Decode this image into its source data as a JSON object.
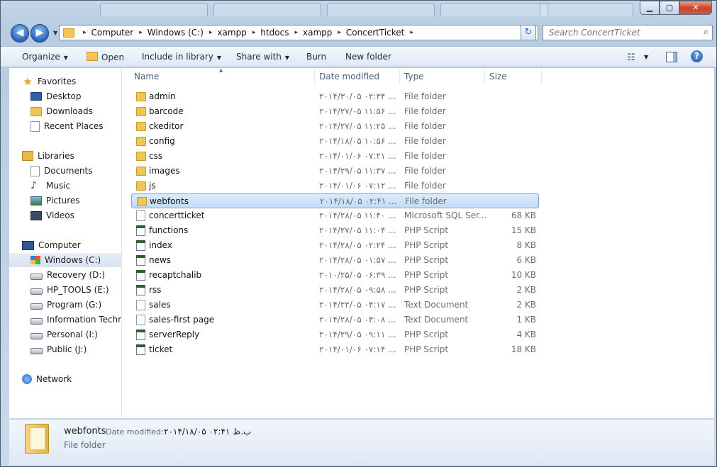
{
  "window": {
    "controls": {
      "minimize": "▁",
      "maximize": "▢",
      "close": "✕"
    }
  },
  "nav": {
    "back": "◀",
    "forward": "▶",
    "dropdown": "▼"
  },
  "address": {
    "crumbs": [
      "Computer",
      "Windows (C:)",
      "xampp",
      "htdocs",
      "xampp",
      "ConcertTicket"
    ],
    "refresh_icon": "↻"
  },
  "search": {
    "placeholder": "Search ConcertTicket"
  },
  "toolbar": {
    "organize": "Organize",
    "open": "Open",
    "include_in_library": "Include in library",
    "share_with": "Share with",
    "burn": "Burn",
    "new_folder": "New folder",
    "help": "?"
  },
  "navpane": {
    "favorites": "Favorites",
    "desktop": "Desktop",
    "downloads": "Downloads",
    "recent_places": "Recent Places",
    "libraries": "Libraries",
    "documents": "Documents",
    "music": "Music",
    "pictures": "Pictures",
    "videos": "Videos",
    "computer": "Computer",
    "drives": [
      "Windows (C:)",
      "Recovery (D:)",
      "HP_TOOLS (E:)",
      "Program (G:)",
      "Information Techno",
      "Personal (I:)",
      "Public (J:)"
    ],
    "network": "Network"
  },
  "columns": {
    "name": "Name",
    "date": "Date modified",
    "type": "Type",
    "size": "Size"
  },
  "files": [
    {
      "name": "admin",
      "date": "۲۰۱۴/۳۰/۰۵ ۰۲:۳۴ ...",
      "type": "File folder",
      "size": "",
      "icon": "folder-icon"
    },
    {
      "name": "barcode",
      "date": "۲۰۱۴/۲۷/۰۵ ۱۱:۵۶ ...",
      "type": "File folder",
      "size": "",
      "icon": "folder-icon"
    },
    {
      "name": "ckeditor",
      "date": "۲۰۱۴/۲۷/۰۵ ۱۱:۲۵ ...",
      "type": "File folder",
      "size": "",
      "icon": "folder-icon"
    },
    {
      "name": "config",
      "date": "۲۰۱۴/۱۸/۰۵ ۱۰:۵۶ ...",
      "type": "File folder",
      "size": "",
      "icon": "folder-icon"
    },
    {
      "name": "css",
      "date": "۲۰۱۴/۰۱/۰۶ ۰۷:۲۱ ...",
      "type": "File folder",
      "size": "",
      "icon": "folder-icon"
    },
    {
      "name": "images",
      "date": "۲۰۱۴/۲۹/۰۵ ۱۱:۳۷ ...",
      "type": "File folder",
      "size": "",
      "icon": "folder-icon"
    },
    {
      "name": "js",
      "date": "۲۰۱۴/۰۱/۰۶ ۰۷:۱۲ ...",
      "type": "File folder",
      "size": "",
      "icon": "folder-icon"
    },
    {
      "name": "webfonts",
      "date": "۲۰۱۴/۱۸/۰۵ ۰۲:۴۱ ...",
      "type": "File folder",
      "size": "",
      "icon": "folder-icon"
    },
    {
      "name": "concertticket",
      "date": "۲۰۱۴/۲۸/۰۵ ۱۱:۴۰ ...",
      "type": "Microsoft SQL Ser...",
      "size": "68 KB",
      "icon": "sql-file-icon"
    },
    {
      "name": "functions",
      "date": "۲۰۱۴/۲۷/۰۵ ۱۱:۰۴ ...",
      "type": "PHP Script",
      "size": "15 KB",
      "icon": "php-file-icon"
    },
    {
      "name": "index",
      "date": "۲۰۱۴/۲۸/۰۵ ۰۲:۲۴ ...",
      "type": "PHP Script",
      "size": "8 KB",
      "icon": "php-file-icon"
    },
    {
      "name": "news",
      "date": "۲۰۱۴/۲۸/۰۵ ۰۱:۵۷ ...",
      "type": "PHP Script",
      "size": "6 KB",
      "icon": "php-file-icon"
    },
    {
      "name": "recaptchalib",
      "date": "۲۰۱۰/۲۵/۰۵ ۰۶:۳۹ ...",
      "type": "PHP Script",
      "size": "10 KB",
      "icon": "php-file-icon"
    },
    {
      "name": "rss",
      "date": "۲۰۱۴/۲۸/۰۵ ۰۹:۵۸ ...",
      "type": "PHP Script",
      "size": "2 KB",
      "icon": "php-file-icon"
    },
    {
      "name": "sales",
      "date": "۲۰۱۴/۲۲/۰۵ ۰۴:۱۷ ...",
      "type": "Text Document",
      "size": "2 KB",
      "icon": "text-file-icon"
    },
    {
      "name": "sales-first page",
      "date": "۲۰۱۴/۲۸/۰۵ ۰۴:۰۸ ...",
      "type": "Text Document",
      "size": "1 KB",
      "icon": "text-file-icon"
    },
    {
      "name": "serverReply",
      "date": "۲۰۱۴/۲۹/۰۵ ۰۹:۱۱ ...",
      "type": "PHP Script",
      "size": "4 KB",
      "icon": "php-file-icon"
    },
    {
      "name": "ticket",
      "date": "۲۰۱۴/۰۱/۰۶ ۰۷:۱۴ ...",
      "type": "PHP Script",
      "size": "18 KB",
      "icon": "php-file-icon"
    }
  ],
  "selected_index": 7,
  "details": {
    "name": "webfonts",
    "date_label": "Date modified:",
    "date_value": "۲۰۱۴/۱۸/۰۵ ۰۲:۴۱ ب.ظ",
    "type": "File folder"
  }
}
